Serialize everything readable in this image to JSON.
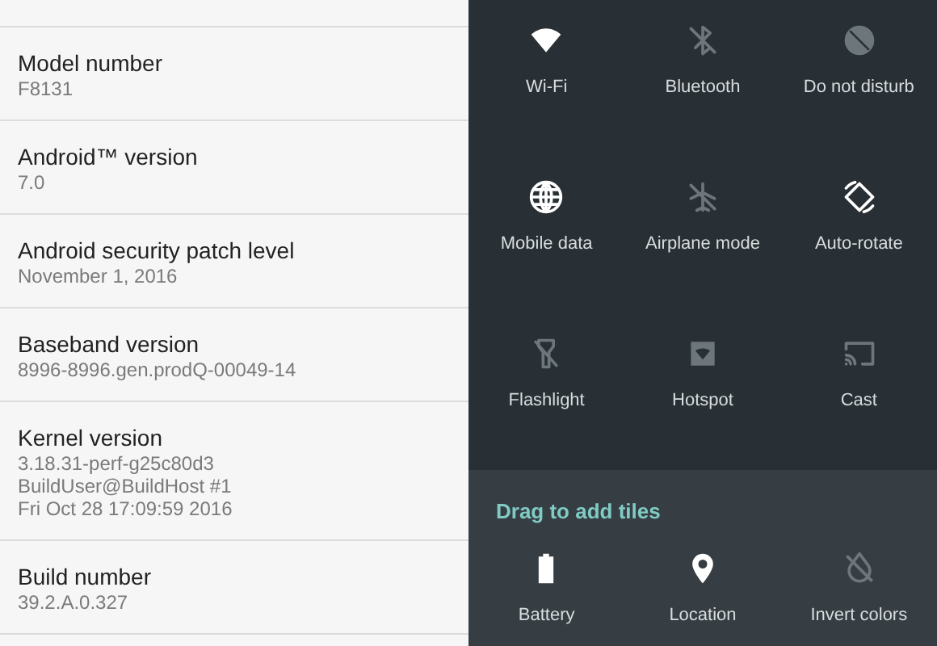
{
  "about": [
    {
      "title": "Model number",
      "lines": [
        "F8131"
      ]
    },
    {
      "title": "Android™ version",
      "lines": [
        "7.0"
      ]
    },
    {
      "title": "Android security patch level",
      "lines": [
        "November 1, 2016"
      ]
    },
    {
      "title": "Baseband version",
      "lines": [
        "8996-8996.gen.prodQ-00049-14"
      ]
    },
    {
      "title": "Kernel version",
      "lines": [
        "3.18.31-perf-g25c80d3",
        "BuildUser@BuildHost #1",
        "Fri Oct 28 17:09:59 2016"
      ]
    },
    {
      "title": "Build number",
      "lines": [
        "39.2.A.0.327"
      ]
    }
  ],
  "tiles": [
    {
      "kind": "wifi",
      "label": "Wi-Fi",
      "on": true
    },
    {
      "kind": "bluetooth",
      "label": "Bluetooth",
      "on": false
    },
    {
      "kind": "dnd",
      "label": "Do not disturb",
      "on": false
    },
    {
      "kind": "globe",
      "label": "Mobile data",
      "on": true
    },
    {
      "kind": "airplane",
      "label": "Airplane mode",
      "on": false
    },
    {
      "kind": "rotate",
      "label": "Auto-rotate",
      "on": true
    },
    {
      "kind": "flashlight",
      "label": "Flashlight",
      "on": false
    },
    {
      "kind": "hotspot",
      "label": "Hotspot",
      "on": false
    },
    {
      "kind": "cast",
      "label": "Cast",
      "on": false
    }
  ],
  "add_section": {
    "heading": "Drag to add tiles",
    "tiles": [
      {
        "kind": "battery",
        "label": "Battery",
        "on": true
      },
      {
        "kind": "location",
        "label": "Location",
        "on": true
      },
      {
        "kind": "invert",
        "label": "Invert colors",
        "on": false
      }
    ]
  }
}
